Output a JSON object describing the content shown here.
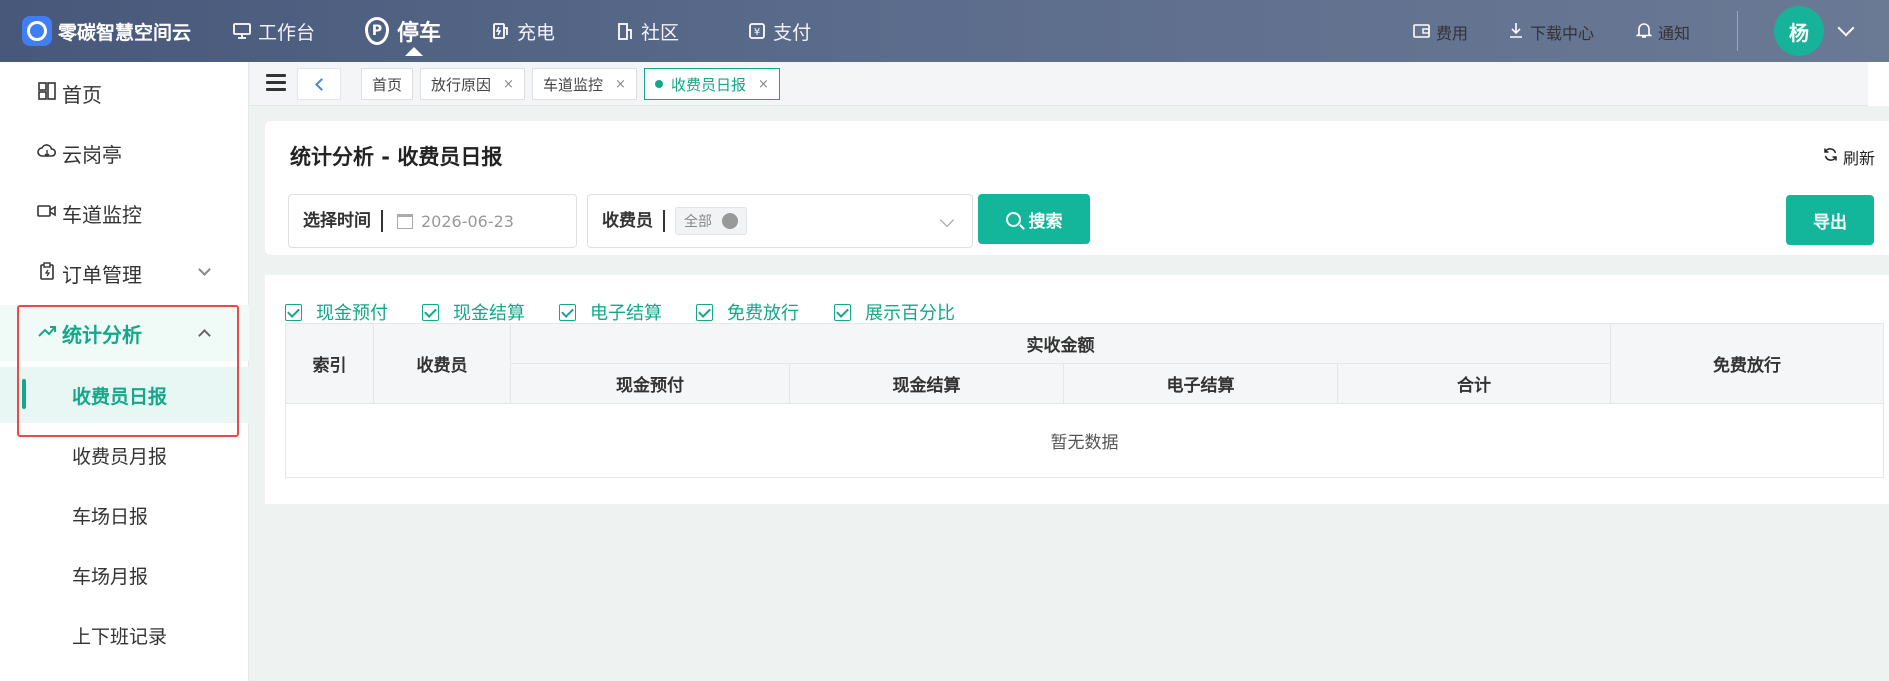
{
  "app": {
    "name": "零碳智慧空间云"
  },
  "nav": [
    {
      "label": "工作台",
      "icon": "monitor-icon"
    },
    {
      "label": "停车",
      "icon": "parking-pin-icon",
      "active": true
    },
    {
      "label": "充电",
      "icon": "charging-icon"
    },
    {
      "label": "社区",
      "icon": "building-icon"
    },
    {
      "label": "支付",
      "icon": "payment-icon"
    }
  ],
  "header_tools": [
    {
      "label": "费用",
      "icon": "wallet-icon"
    },
    {
      "label": "下载中心",
      "icon": "download-icon"
    },
    {
      "label": "通知",
      "icon": "bell-icon"
    }
  ],
  "user": {
    "avatar_text": "杨"
  },
  "sidebar": {
    "items": [
      {
        "label": "首页",
        "icon": "dashboard-icon"
      },
      {
        "label": "云岗亭",
        "icon": "cloud-icon"
      },
      {
        "label": "车道监控",
        "icon": "camera-icon"
      },
      {
        "label": "订单管理",
        "icon": "order-icon"
      },
      {
        "label": "统计分析",
        "icon": "trend-icon"
      }
    ],
    "subitems": [
      {
        "label": "收费员日报",
        "active": true
      },
      {
        "label": "收费员月报"
      },
      {
        "label": "车场日报"
      },
      {
        "label": "车场月报"
      },
      {
        "label": "上下班记录"
      }
    ]
  },
  "tabs": [
    {
      "label": "首页"
    },
    {
      "label": "放行原因"
    },
    {
      "label": "车道监控"
    },
    {
      "label": "收费员日报",
      "active": true
    }
  ],
  "page": {
    "title": "统计分析 - 收费员日报",
    "refresh_label": "刷新",
    "date_label": "选择时间",
    "date_value": "2026-06-23",
    "collector_label": "收费员",
    "collector_chip": "全部",
    "search_label": "搜索",
    "export_label": "导出"
  },
  "options": [
    "现金预付",
    "现金结算",
    "电子结算",
    "免费放行",
    "展示百分比"
  ],
  "table": {
    "col_index": "索引",
    "col_collector": "收费员",
    "group_amount": "实收金额",
    "sub_cols": [
      "现金预付",
      "现金结算",
      "电子结算",
      "合计"
    ],
    "col_free": "免费放行",
    "empty_text": "暂无数据"
  },
  "colors": {
    "accent": "#13b59b",
    "header_bg": "#4f6080",
    "highlight_box": "#e84a4a"
  }
}
